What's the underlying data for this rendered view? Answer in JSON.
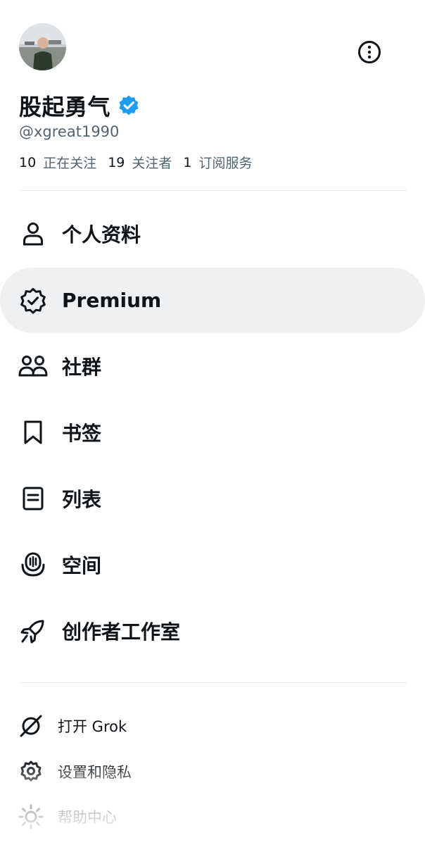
{
  "profile": {
    "display_name": "股起勇气",
    "handle": "@xgreat1990",
    "verified_color": "#1d9bf0"
  },
  "stats": [
    {
      "count": "10",
      "label": "正在关注"
    },
    {
      "count": "19",
      "label": "关注者"
    },
    {
      "count": "1",
      "label": "订阅服务"
    }
  ],
  "menu": [
    {
      "icon": "person-icon",
      "label": "个人资料"
    },
    {
      "icon": "premium-badge-icon",
      "label": "Premium"
    },
    {
      "icon": "communities-icon",
      "label": "社群"
    },
    {
      "icon": "bookmark-icon",
      "label": "书签"
    },
    {
      "icon": "list-icon",
      "label": "列表"
    },
    {
      "icon": "spaces-icon",
      "label": "空间"
    },
    {
      "icon": "rocket-icon",
      "label": "创作者工作室"
    }
  ],
  "secondary_menu": [
    {
      "icon": "grok-icon",
      "label": "打开 Grok"
    },
    {
      "icon": "gear-icon",
      "label": "设置和隐私"
    },
    {
      "icon": "lightbulb-icon",
      "label": "帮助中心"
    }
  ],
  "colors": {
    "text_primary": "#0f1419",
    "text_secondary": "#536471",
    "active_background": "#eff0f1",
    "divider": "#e7e9ea"
  }
}
